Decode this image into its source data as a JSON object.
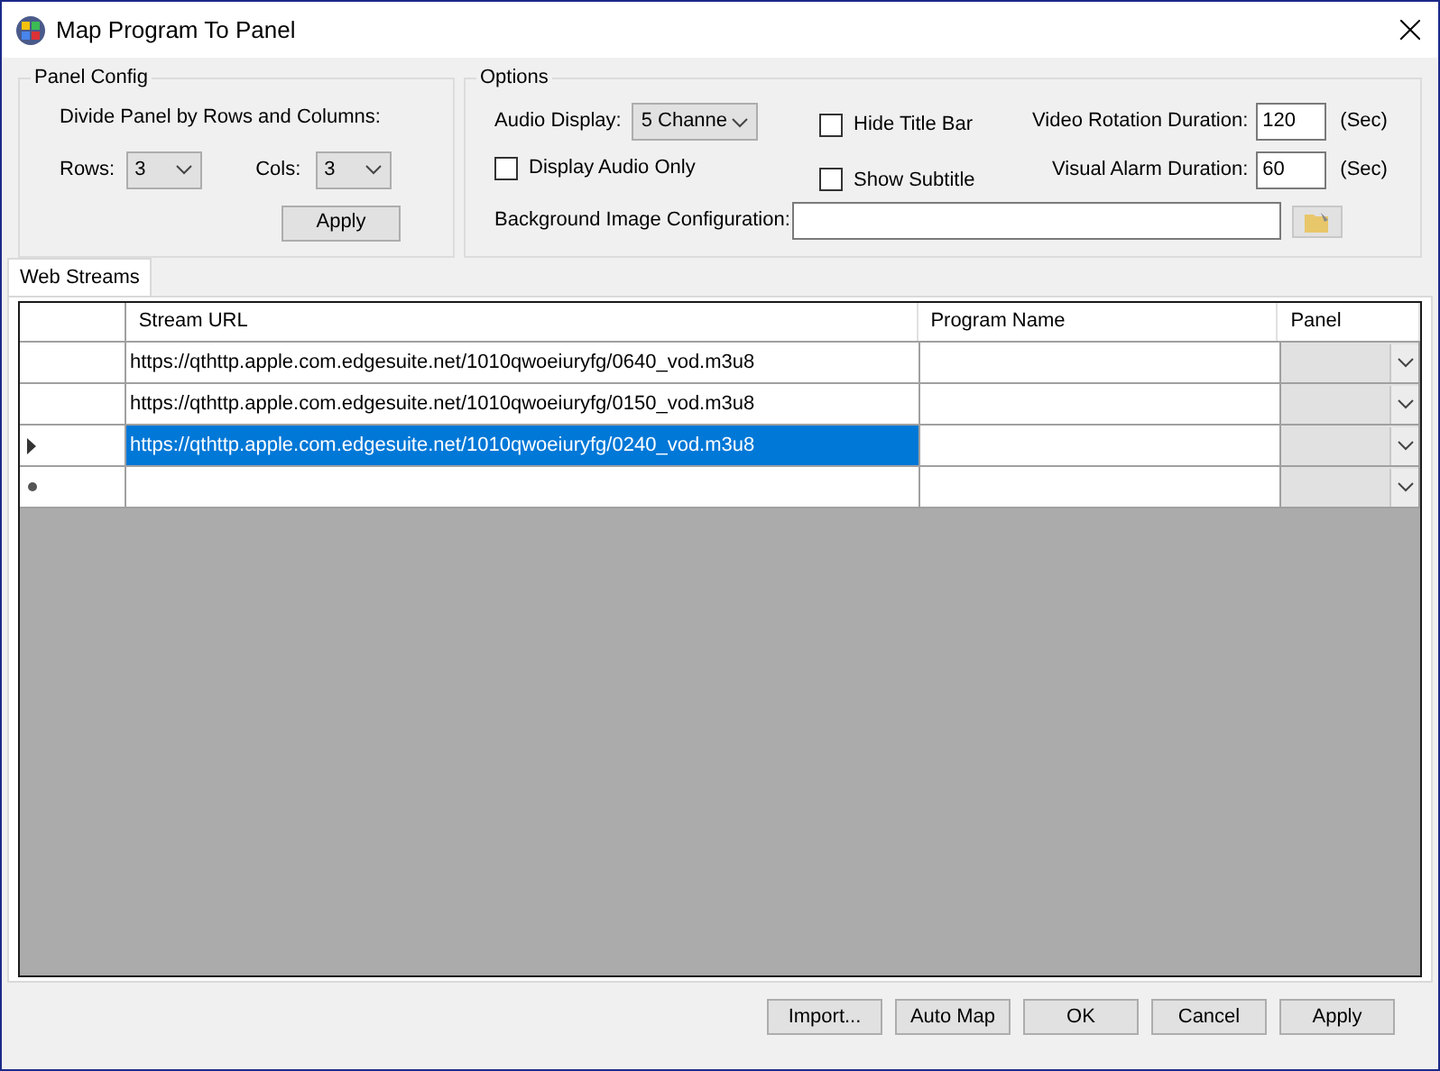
{
  "window": {
    "title": "Map Program To Panel"
  },
  "panel_config": {
    "title": "Panel Config",
    "caption": "Divide Panel by Rows and Columns:",
    "rows_label": "Rows:",
    "rows_value": "3",
    "cols_label": "Cols:",
    "cols_value": "3",
    "apply": "Apply"
  },
  "options": {
    "title": "Options",
    "audio_display_label": "Audio Display:",
    "audio_display_value": "5 Channe",
    "checkboxes": [
      {
        "label": "Hide Title Bar",
        "checked": false
      },
      {
        "label": "Show Subtitle",
        "checked": false
      },
      {
        "label": "Display Audio Only",
        "checked": false
      }
    ],
    "video_rotation_label": "Video Rotation Duration:",
    "video_rotation_value": "120",
    "video_rotation_unit": "(Sec)",
    "visual_alarm_label": "Visual Alarm Duration:",
    "visual_alarm_value": "60",
    "visual_alarm_unit": "(Sec)",
    "background_label": "Background Image Configuration:"
  },
  "tabs": [
    {
      "label": "Web Streams",
      "selected": true
    }
  ],
  "table": {
    "columns": [
      "Stream URL",
      "Program Name",
      "Panel"
    ],
    "rows": [
      {
        "kind": "data",
        "selected": false,
        "url": "https://qthttp.apple.com.edgesuite.net/1010qwoeiuryfg/0640_vod.m3u8"
      },
      {
        "kind": "data",
        "selected": false,
        "url": "https://qthttp.apple.com.edgesuite.net/1010qwoeiuryfg/0150_vod.m3u8"
      },
      {
        "kind": "data",
        "selected": true,
        "url": "https://qthttp.apple.com.edgesuite.net/1010qwoeiuryfg/0240_vod.m3u8"
      },
      {
        "kind": "new",
        "selected": false
      }
    ]
  },
  "buttons": [
    "Import...",
    "Auto Map",
    "OK",
    "Cancel",
    "Apply"
  ]
}
